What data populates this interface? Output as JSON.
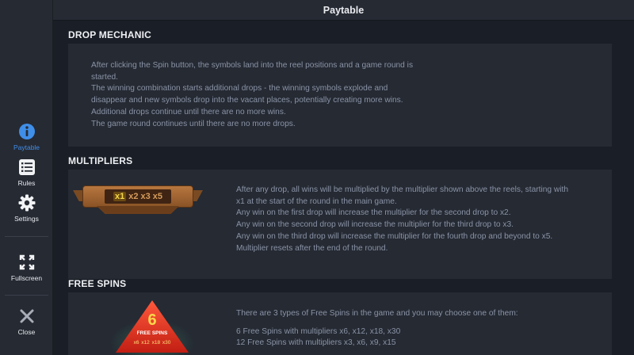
{
  "header": {
    "title": "Paytable"
  },
  "sidebar": {
    "items": [
      {
        "label": "Paytable",
        "icon": "info-icon",
        "active": true
      },
      {
        "label": "Rules",
        "icon": "list-icon"
      },
      {
        "label": "Settings",
        "icon": "gear-icon"
      },
      {
        "label": "Fullscreen",
        "icon": "fullscreen-icon"
      },
      {
        "label": "Close",
        "icon": "close-icon"
      }
    ],
    "active_color": "#3f8ee8"
  },
  "sections": {
    "drop": {
      "title": "DROP MECHANIC",
      "lines": [
        "After clicking the Spin button, the symbols land into the reel positions and a game round is",
        "started.",
        "The winning combination starts additional drops - the winning symbols explode and",
        "disappear and new symbols drop into the vacant places, potentially creating more wins.",
        "Additional drops continue until there are no more wins.",
        "The game round continues until there are no more drops."
      ]
    },
    "multipliers": {
      "title": "MULTIPLIERS",
      "banner": {
        "current": "x1",
        "rest": [
          "x2",
          "x3",
          "x5"
        ]
      },
      "lines": [
        "After any drop, all wins will be multiplied by the multiplier shown above the reels, starting with",
        "x1 at the start of the round in the main game.",
        "Any win on the first drop will increase the multiplier for the second drop to x2.",
        "Any win on the second drop will increase the multiplier for the third drop to x3.",
        "Any win on the third drop will increase the multiplier for the fourth drop and beyond to x5.",
        "Multiplier resets after the end of the round."
      ]
    },
    "freespins": {
      "title": "FREE SPINS",
      "badge": {
        "number": "6",
        "label": "FREE SPINS",
        "mults": "x6 x12 x18 x30"
      },
      "intro": "There are 3 types of Free Spins in the game and you may choose one of them:",
      "lines": [
        "6 Free Spins with multipliers x6, x12, x18, x30",
        "12 Free Spins with multipliers x3, x6, x9, x15"
      ]
    }
  }
}
